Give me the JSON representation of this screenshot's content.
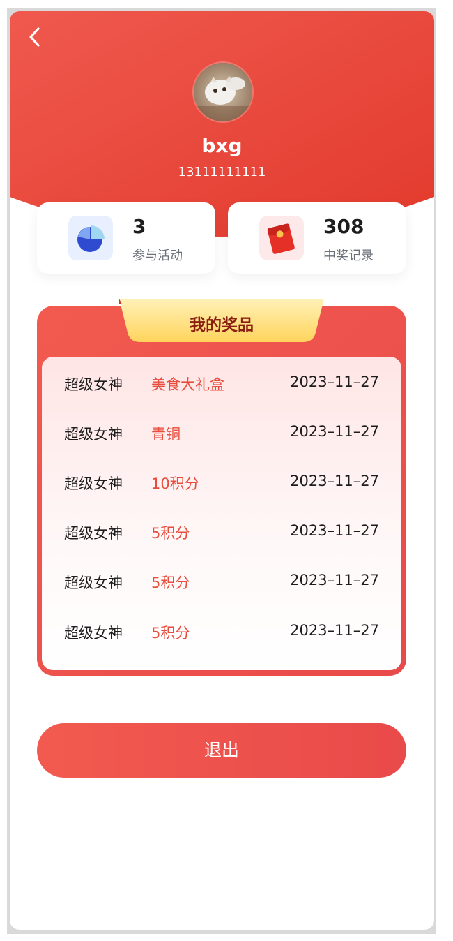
{
  "header": {
    "back_icon": "chevron-left-icon",
    "username": "bxg",
    "phone": "13111111111",
    "gradient_colors": [
      "#f0594e",
      "#e23a2d"
    ]
  },
  "stats": [
    {
      "value": "3",
      "label": "参与活动",
      "icon": "pie-chart-icon",
      "icon_bg": "#e8efff"
    },
    {
      "value": "308",
      "label": "中奖记录",
      "icon": "red-envelope-icon",
      "icon_bg": "#fde9ea"
    }
  ],
  "prizes": {
    "title": "我的奖品",
    "rows": [
      {
        "name": "超级女神",
        "prize": "美食大礼盒",
        "date": "2023–11–27"
      },
      {
        "name": "超级女神",
        "prize": "青铜",
        "date": "2023–11–27"
      },
      {
        "name": "超级女神",
        "prize": "10积分",
        "date": "2023–11–27"
      },
      {
        "name": "超级女神",
        "prize": "5积分",
        "date": "2023–11–27"
      },
      {
        "name": "超级女神",
        "prize": "5积分",
        "date": "2023–11–27"
      },
      {
        "name": "超级女神",
        "prize": "5积分",
        "date": "2023–11–27"
      }
    ]
  },
  "logout": {
    "label": "退出"
  },
  "colors": {
    "accent": "#e94a4a",
    "prize_text": "#e84c3d",
    "tab_gold": "#ffd86a"
  }
}
